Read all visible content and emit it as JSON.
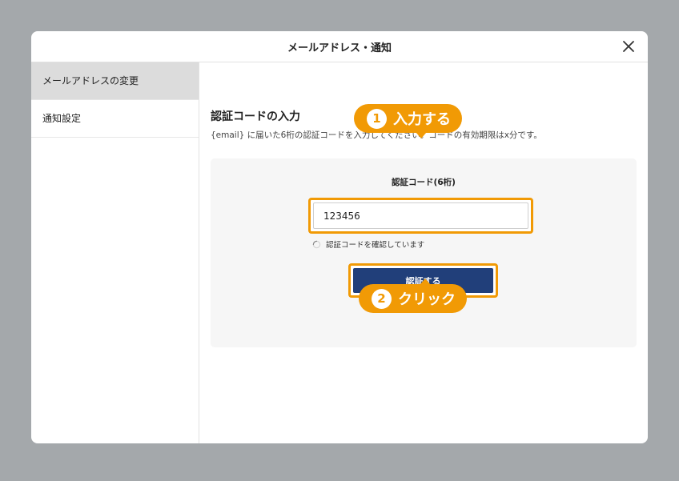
{
  "modal": {
    "title": "メールアドレス・通知"
  },
  "sidebar": {
    "items": [
      {
        "label": "メールアドレスの変更",
        "active": true
      },
      {
        "label": "通知設定",
        "active": false
      }
    ]
  },
  "content": {
    "section_title": "認証コードの入力",
    "description": "{email} に届いた6桁の認証コードを入力してください。コードの有効期限はx分です。",
    "code_label": "認証コード(6桁)",
    "code_value": "123456",
    "status_text": "認証コードを確認しています",
    "verify_button_label": "認証する"
  },
  "annotations": [
    {
      "number": "1",
      "text": "入力する"
    },
    {
      "number": "2",
      "text": "クリック"
    }
  ],
  "colors": {
    "accent_orange": "#f19a05",
    "button_navy": "#213f7a",
    "sidebar_active": "#dcdcdc",
    "overlay_backdrop": "#a4a8ab"
  }
}
